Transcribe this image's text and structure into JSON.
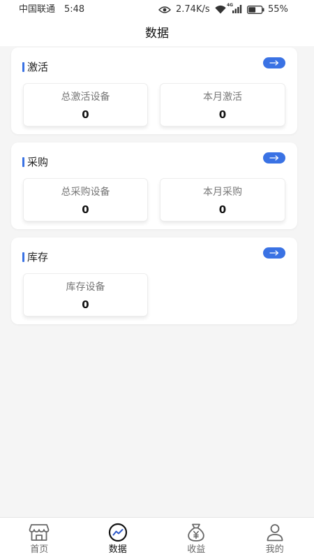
{
  "status_bar": {
    "carrier": "中国联通",
    "time": "5:48",
    "net_speed": "2.74K/s",
    "network_type": "4G",
    "battery": "55%",
    "battery_level": 0.55,
    "icons": {
      "visibility": "eye-icon",
      "wifi": "wifi-icon",
      "signal": "signal-icon",
      "battery": "battery-icon"
    }
  },
  "header": {
    "title": "数据"
  },
  "sections": [
    {
      "title": "激活",
      "action_icon": "arrow-right-icon",
      "stats": [
        {
          "label": "总激活设备",
          "value": "0"
        },
        {
          "label": "本月激活",
          "value": "0"
        }
      ]
    },
    {
      "title": "采购",
      "action_icon": "arrow-right-icon",
      "stats": [
        {
          "label": "总采购设备",
          "value": "0"
        },
        {
          "label": "本月采购",
          "value": "0"
        }
      ]
    },
    {
      "title": "库存",
      "action_icon": "arrow-right-icon",
      "stats": [
        {
          "label": "库存设备",
          "value": "0"
        }
      ]
    }
  ],
  "tabbar": {
    "items": [
      {
        "label": "首页",
        "icon": "store-icon",
        "active": false
      },
      {
        "label": "数据",
        "icon": "chart-icon",
        "active": true
      },
      {
        "label": "收益",
        "icon": "money-bag-icon",
        "active": false
      },
      {
        "label": "我的",
        "icon": "person-icon",
        "active": false
      }
    ]
  },
  "colors": {
    "accent": "#3a72e4",
    "background": "#f5f5f5",
    "card": "#ffffff",
    "text_primary": "#1a1a1a",
    "text_secondary": "#777777",
    "tab_active": "#111111",
    "tab_inactive": "#666666",
    "status_text": "#333333"
  }
}
